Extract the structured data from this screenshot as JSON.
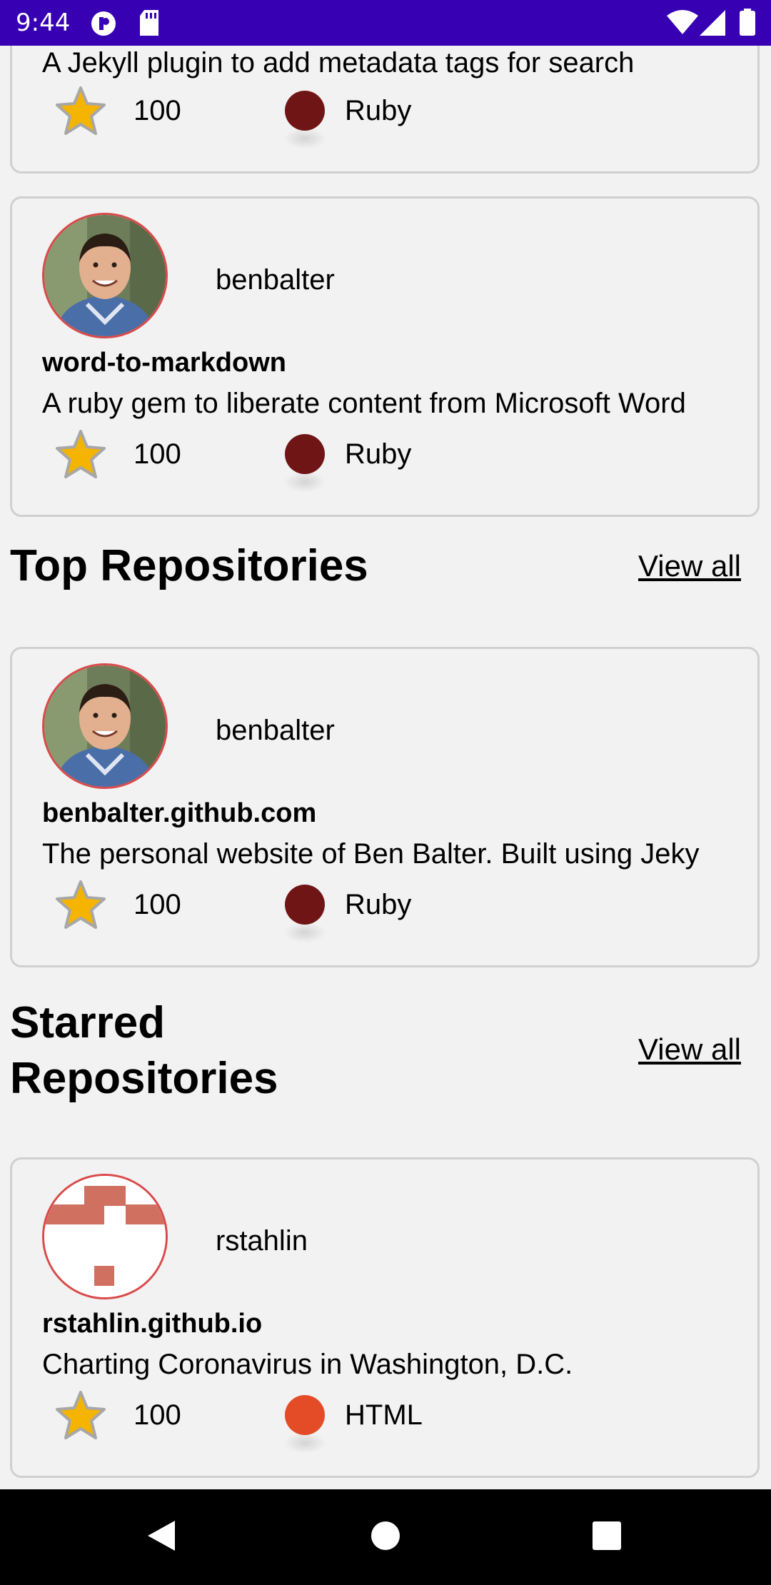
{
  "status_bar": {
    "time": "9:44",
    "icons": [
      "app-notification-icon",
      "sd-card-icon",
      "wifi-icon",
      "signal-icon",
      "battery-icon"
    ]
  },
  "cards_top": [
    {
      "description": "A Jekyll plugin to add metadata tags for search",
      "stars": "100",
      "language": "Ruby",
      "language_color": "#701516"
    },
    {
      "owner": "benbalter",
      "name": "word-to-markdown",
      "description": "A ruby gem to liberate content from Microsoft Word",
      "stars": "100",
      "language": "Ruby",
      "language_color": "#701516"
    }
  ],
  "top_repositories": {
    "title": "Top Repositories",
    "view_all": "View all",
    "items": [
      {
        "owner": "benbalter",
        "name": "benbalter.github.com",
        "description": "The personal website of Ben Balter. Built using Jeky",
        "stars": "100",
        "language": "Ruby",
        "language_color": "#701516"
      }
    ]
  },
  "starred_repositories": {
    "title_line1": "Starred",
    "title_line2": "Repositories",
    "view_all": "View all",
    "items": [
      {
        "owner": "rstahlin",
        "name": "rstahlin.github.io",
        "description": "Charting Coronavirus in Washington, D.C.",
        "stars": "100",
        "language": "HTML",
        "language_color": "#e34c26"
      }
    ]
  },
  "nav_bar": {
    "buttons": [
      "back-icon",
      "home-icon",
      "recents-icon"
    ]
  }
}
